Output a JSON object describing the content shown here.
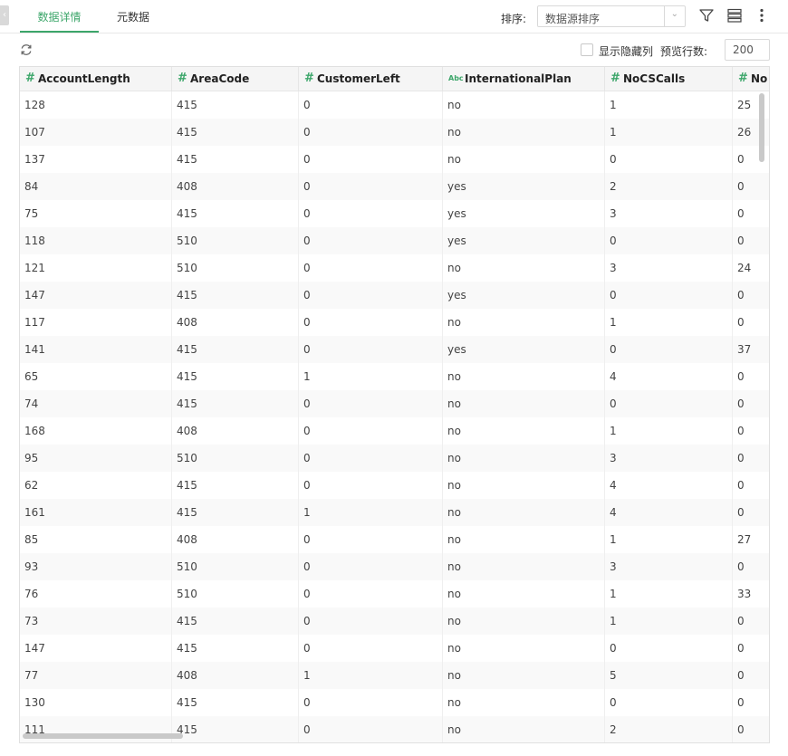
{
  "tabs": [
    {
      "label": "数据详情",
      "active": true
    },
    {
      "label": "元数据",
      "active": false
    }
  ],
  "sort": {
    "label": "排序:",
    "value": "数据源排序"
  },
  "options": {
    "show_hidden_label": "显示隐藏列",
    "preview_rows_label": "预览行数:",
    "preview_rows_value": "200"
  },
  "icons": {
    "filter": "filter-icon",
    "layout": "list-layout-icon",
    "more": "more-vertical-icon",
    "refresh": "refresh-icon"
  },
  "colors": {
    "accent": "#3ca66a",
    "header_bg": "#f5f5f5",
    "alt_row": "#f9f9f9"
  },
  "columns": [
    {
      "type": "#",
      "name": "AccountLength"
    },
    {
      "type": "#",
      "name": "AreaCode"
    },
    {
      "type": "#",
      "name": "CustomerLeft"
    },
    {
      "type": "Abc",
      "name": "InternationalPlan"
    },
    {
      "type": "#",
      "name": "NoCSCalls"
    },
    {
      "type": "#",
      "name": "No"
    }
  ],
  "rows": [
    [
      "128",
      "415",
      "0",
      "no",
      "1",
      "25"
    ],
    [
      "107",
      "415",
      "0",
      "no",
      "1",
      "26"
    ],
    [
      "137",
      "415",
      "0",
      "no",
      "0",
      "0"
    ],
    [
      "84",
      "408",
      "0",
      "yes",
      "2",
      "0"
    ],
    [
      "75",
      "415",
      "0",
      "yes",
      "3",
      "0"
    ],
    [
      "118",
      "510",
      "0",
      "yes",
      "0",
      "0"
    ],
    [
      "121",
      "510",
      "0",
      "no",
      "3",
      "24"
    ],
    [
      "147",
      "415",
      "0",
      "yes",
      "0",
      "0"
    ],
    [
      "117",
      "408",
      "0",
      "no",
      "1",
      "0"
    ],
    [
      "141",
      "415",
      "0",
      "yes",
      "0",
      "37"
    ],
    [
      "65",
      "415",
      "1",
      "no",
      "4",
      "0"
    ],
    [
      "74",
      "415",
      "0",
      "no",
      "0",
      "0"
    ],
    [
      "168",
      "408",
      "0",
      "no",
      "1",
      "0"
    ],
    [
      "95",
      "510",
      "0",
      "no",
      "3",
      "0"
    ],
    [
      "62",
      "415",
      "0",
      "no",
      "4",
      "0"
    ],
    [
      "161",
      "415",
      "1",
      "no",
      "4",
      "0"
    ],
    [
      "85",
      "408",
      "0",
      "no",
      "1",
      "27"
    ],
    [
      "93",
      "510",
      "0",
      "no",
      "3",
      "0"
    ],
    [
      "76",
      "510",
      "0",
      "no",
      "1",
      "33"
    ],
    [
      "73",
      "415",
      "0",
      "no",
      "1",
      "0"
    ],
    [
      "147",
      "415",
      "0",
      "no",
      "0",
      "0"
    ],
    [
      "77",
      "408",
      "1",
      "no",
      "5",
      "0"
    ],
    [
      "130",
      "415",
      "0",
      "no",
      "0",
      "0"
    ],
    [
      "111",
      "415",
      "0",
      "no",
      "2",
      "0"
    ]
  ]
}
